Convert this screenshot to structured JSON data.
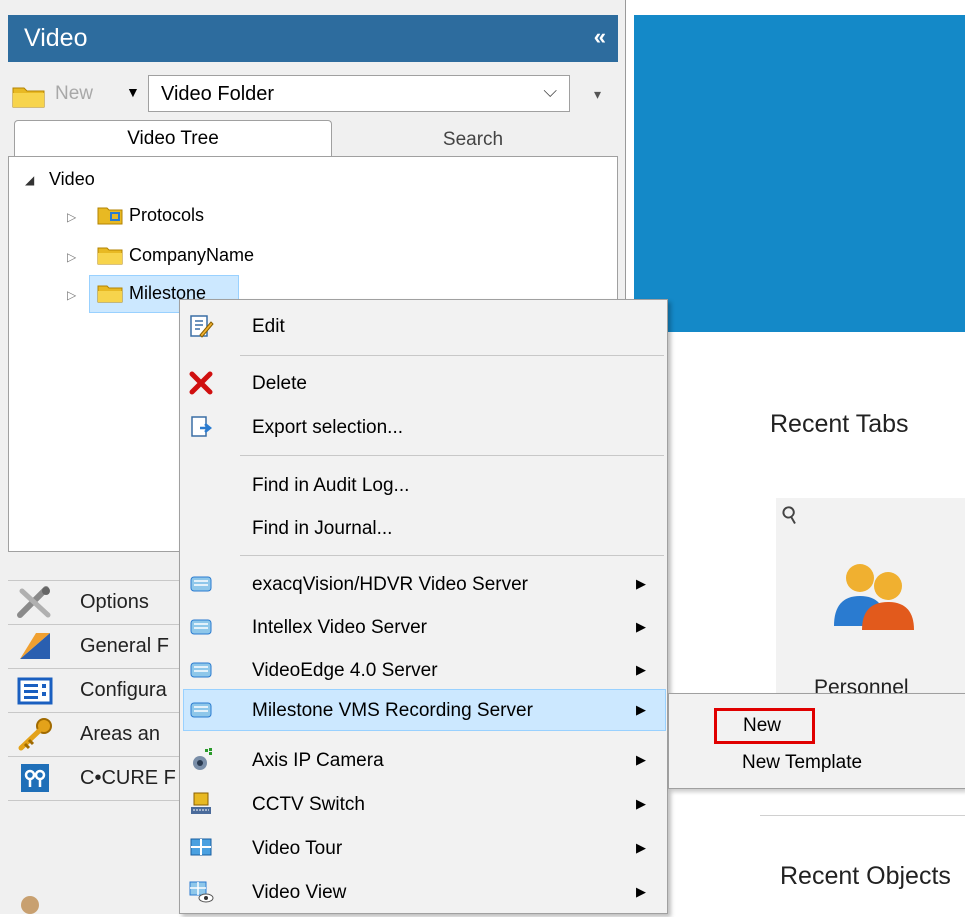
{
  "panel": {
    "title": "Video",
    "collapse_glyph": "«",
    "toolbar": {
      "new_label": "New",
      "select_value": "Video Folder"
    },
    "tabs": {
      "video_tree": "Video Tree",
      "search": "Search"
    },
    "tree": {
      "root": "Video",
      "children": [
        "Protocols",
        "CompanyName",
        "Milestone"
      ]
    },
    "nav": [
      "Options",
      "General F",
      "Configura",
      "Areas an",
      "C•CURE F"
    ]
  },
  "context_menu": {
    "items": [
      {
        "label": "Edit",
        "icon": "edit-icon"
      },
      {
        "label": "Delete",
        "icon": "delete-icon"
      },
      {
        "label": "Export selection...",
        "icon": "export-icon"
      },
      {
        "label": "Find in Audit Log...",
        "icon": ""
      },
      {
        "label": "Find in Journal...",
        "icon": ""
      },
      {
        "label": "exacqVision/HDVR Video Server",
        "icon": "video-server-icon",
        "submenu": true
      },
      {
        "label": "Intellex Video Server",
        "icon": "video-server-icon",
        "submenu": true
      },
      {
        "label": "VideoEdge 4.0 Server",
        "icon": "video-server-icon",
        "submenu": true
      },
      {
        "label": "Milestone VMS Recording Server",
        "icon": "video-server-icon",
        "submenu": true,
        "highlighted": true
      },
      {
        "label": "Axis IP Camera",
        "icon": "ip-camera-icon",
        "submenu": true
      },
      {
        "label": "CCTV Switch",
        "icon": "cctv-switch-icon",
        "submenu": true
      },
      {
        "label": "Video Tour",
        "icon": "video-tour-icon",
        "submenu": true
      },
      {
        "label": "Video View",
        "icon": "video-view-icon",
        "submenu": true
      }
    ]
  },
  "submenu": {
    "items": [
      "New",
      "New Template"
    ]
  },
  "right": {
    "recent_tabs_title": "Recent Tabs",
    "card_label": "Personnel",
    "recent_objects_title": "Recent Objects"
  },
  "colors": {
    "header_blue": "#2d6c9e",
    "banner_blue": "#1489c8",
    "highlight": "#cce8ff",
    "red_box": "#e00000"
  }
}
